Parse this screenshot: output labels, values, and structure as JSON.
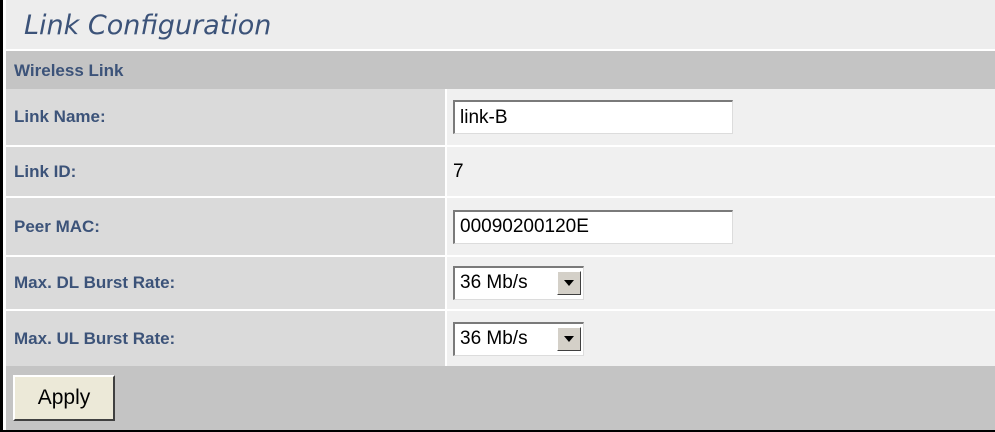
{
  "page": {
    "title": "Link Configuration"
  },
  "section": {
    "title": "Wireless Link"
  },
  "fields": [
    {
      "label": "Link Name:",
      "type": "text",
      "value": "link-B"
    },
    {
      "label": "Link ID:",
      "type": "static",
      "value": "7"
    },
    {
      "label": "Peer MAC:",
      "type": "text",
      "value": "00090200120E"
    },
    {
      "label": "Max. DL Burst Rate:",
      "type": "select",
      "value": "36 Mb/s"
    },
    {
      "label": "Max. UL Burst Rate:",
      "type": "select",
      "value": "36 Mb/s"
    }
  ],
  "actions": {
    "apply_label": "Apply"
  },
  "icons": {
    "dropdown": "triangle-down-icon"
  },
  "colors": {
    "label_text": "#3c5379",
    "section_bg": "#c4c4c4",
    "label_bg": "#dadada",
    "value_bg": "#f0f0f0"
  }
}
